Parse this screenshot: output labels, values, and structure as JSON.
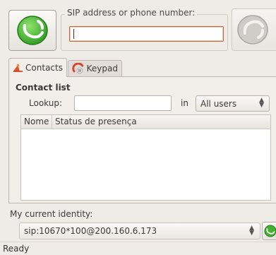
{
  "call": {
    "sip_label": "SIP address or phone number:",
    "sip_value": "",
    "call_icon": "call-icon",
    "hangup_icon": "hangup-icon"
  },
  "tabs": [
    {
      "label": "Contacts",
      "icon": "contacts-icon",
      "active": true
    },
    {
      "label": "Keypad",
      "icon": "keypad-icon",
      "active": false
    }
  ],
  "contacts": {
    "title": "Contact list",
    "lookup_label": "Lookup:",
    "lookup_value": "",
    "in_label": "in",
    "filter_selected": "All users",
    "columns": [
      "Nome",
      "Status de presença"
    ],
    "rows": []
  },
  "identity": {
    "label": "My current identity:",
    "selected": "sip:10670*100@200.160.6.173"
  },
  "status": "Ready",
  "colors": {
    "accent_green": "#3fae2e",
    "focus_border": "#c6643c",
    "background": "#efebe7"
  }
}
